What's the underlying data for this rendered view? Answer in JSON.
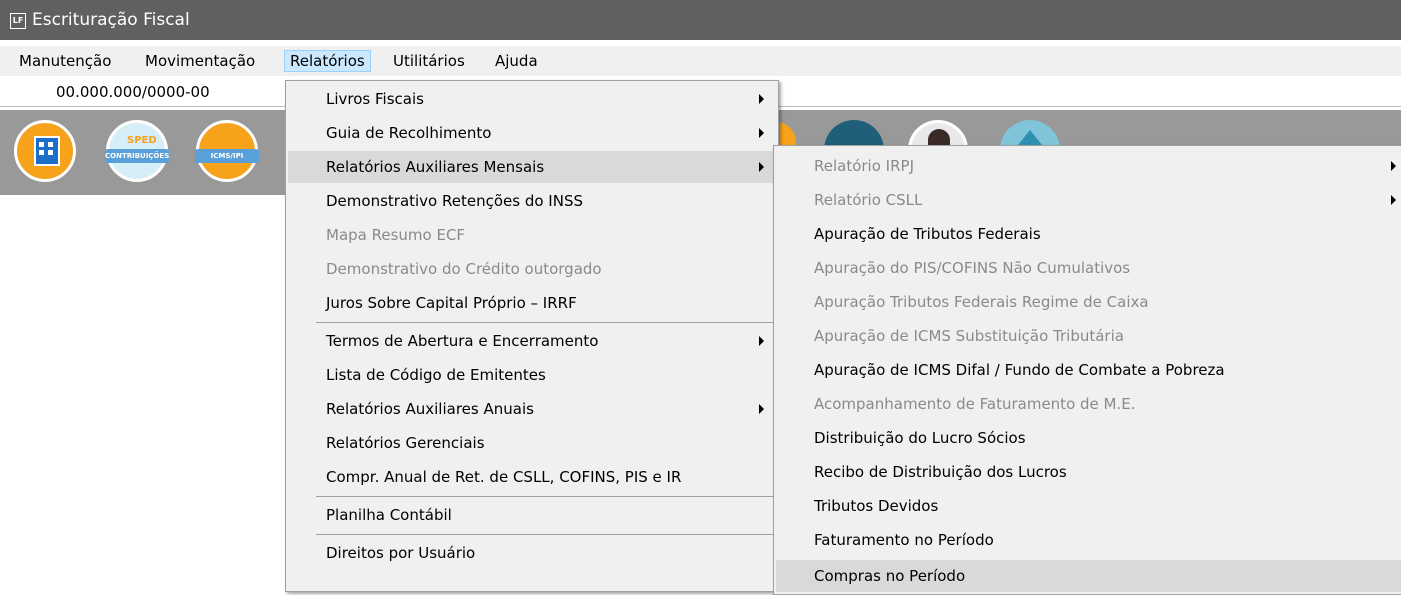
{
  "window": {
    "icon_text": "LF",
    "title": "Escrituração Fiscal"
  },
  "menubar": {
    "items": [
      "Manutenção",
      "Movimentação",
      "Relatórios",
      "Utilitários",
      "Ajuda"
    ]
  },
  "company": {
    "cnpj": "00.000.000/0000-00"
  },
  "toolbar": {
    "sped_word": "SPED",
    "sped_badge": "CONTRIBUIÇÕES",
    "icms_badge": "ICMS/IPI"
  },
  "menu_relatorios": {
    "items": [
      {
        "label": "Livros Fiscais",
        "submenu": true,
        "disabled": false
      },
      {
        "label": "Guia de Recolhimento",
        "submenu": true,
        "disabled": false
      },
      {
        "label": "Relatórios Auxiliares Mensais",
        "submenu": true,
        "disabled": false,
        "highlighted": true
      },
      {
        "label": "Demonstrativo Retenções do INSS",
        "submenu": false,
        "disabled": false
      },
      {
        "label": "Mapa Resumo ECF",
        "submenu": false,
        "disabled": true
      },
      {
        "label": "Demonstrativo do Crédito outorgado",
        "submenu": false,
        "disabled": true
      },
      {
        "label": "Juros Sobre Capital Próprio – IRRF",
        "submenu": false,
        "disabled": false
      },
      {
        "label": "Termos de Abertura e Encerramento",
        "submenu": true,
        "disabled": false
      },
      {
        "label": "Lista de Código de Emitentes",
        "submenu": false,
        "disabled": false
      },
      {
        "label": "Relatórios Auxiliares Anuais",
        "submenu": true,
        "disabled": false
      },
      {
        "label": "Relatórios Gerenciais",
        "submenu": false,
        "disabled": false
      },
      {
        "label": "Compr. Anual de Ret. de CSLL, COFINS,  PIS e IR",
        "submenu": false,
        "disabled": false
      },
      {
        "label": "Planilha Contábil",
        "submenu": false,
        "disabled": false
      },
      {
        "label": "Direitos por Usuário",
        "submenu": false,
        "disabled": false
      }
    ]
  },
  "menu_aux_mensais": {
    "items": [
      {
        "label": "Relatório IRPJ",
        "submenu": true,
        "disabled": true
      },
      {
        "label": "Relatório CSLL",
        "submenu": true,
        "disabled": true
      },
      {
        "label": "Apuração de Tributos Federais",
        "submenu": false,
        "disabled": false
      },
      {
        "label": "Apuração do PIS/COFINS Não Cumulativos",
        "submenu": false,
        "disabled": true
      },
      {
        "label": "Apuração Tributos Federais Regime de Caixa",
        "submenu": false,
        "disabled": true
      },
      {
        "label": "Apuração de ICMS Substituição Tributária",
        "submenu": false,
        "disabled": true
      },
      {
        "label": "Apuração de ICMS Difal / Fundo de Combate a Pobreza",
        "submenu": false,
        "disabled": false
      },
      {
        "label": "Acompanhamento de Faturamento de M.E.",
        "submenu": false,
        "disabled": true
      },
      {
        "label": "Distribuição do Lucro Sócios",
        "submenu": false,
        "disabled": false
      },
      {
        "label": "Recibo de Distribuição dos Lucros",
        "submenu": false,
        "disabled": false
      },
      {
        "label": "Tributos Devidos",
        "submenu": false,
        "disabled": false
      },
      {
        "label": "Faturamento no Período",
        "submenu": false,
        "disabled": false
      },
      {
        "label": "Compras no Período",
        "submenu": false,
        "disabled": false,
        "highlighted": true
      }
    ]
  },
  "colors": {
    "titlebar": "#606060",
    "toolbar": "#999999",
    "menu_bg": "#f0f0f0",
    "menubar_active": "#cce8ff",
    "disabled_text": "#8a8a8a"
  }
}
